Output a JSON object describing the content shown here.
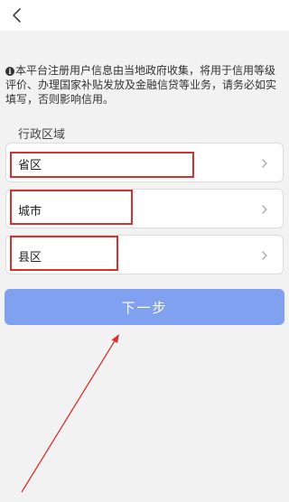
{
  "header": {
    "back_icon": "chevron-left-icon"
  },
  "notice": {
    "icon": "info-icon",
    "text": "本平台注册用户信息由当地政府收集，将用于信用等级评价、办理国家补贴发放及金融信贷等业务，请务必如实填写，否则影响信用。"
  },
  "form": {
    "section_label": "行政区域",
    "fields": [
      {
        "label": "省区",
        "icon": "chevron-right-icon"
      },
      {
        "label": "城市",
        "icon": "chevron-right-icon"
      },
      {
        "label": "县区",
        "icon": "chevron-right-icon"
      }
    ],
    "next_label": "下一步"
  },
  "colors": {
    "primary_button": "#7fa1ef",
    "annotation": "#d9302f",
    "background": "#f2f2f2"
  }
}
